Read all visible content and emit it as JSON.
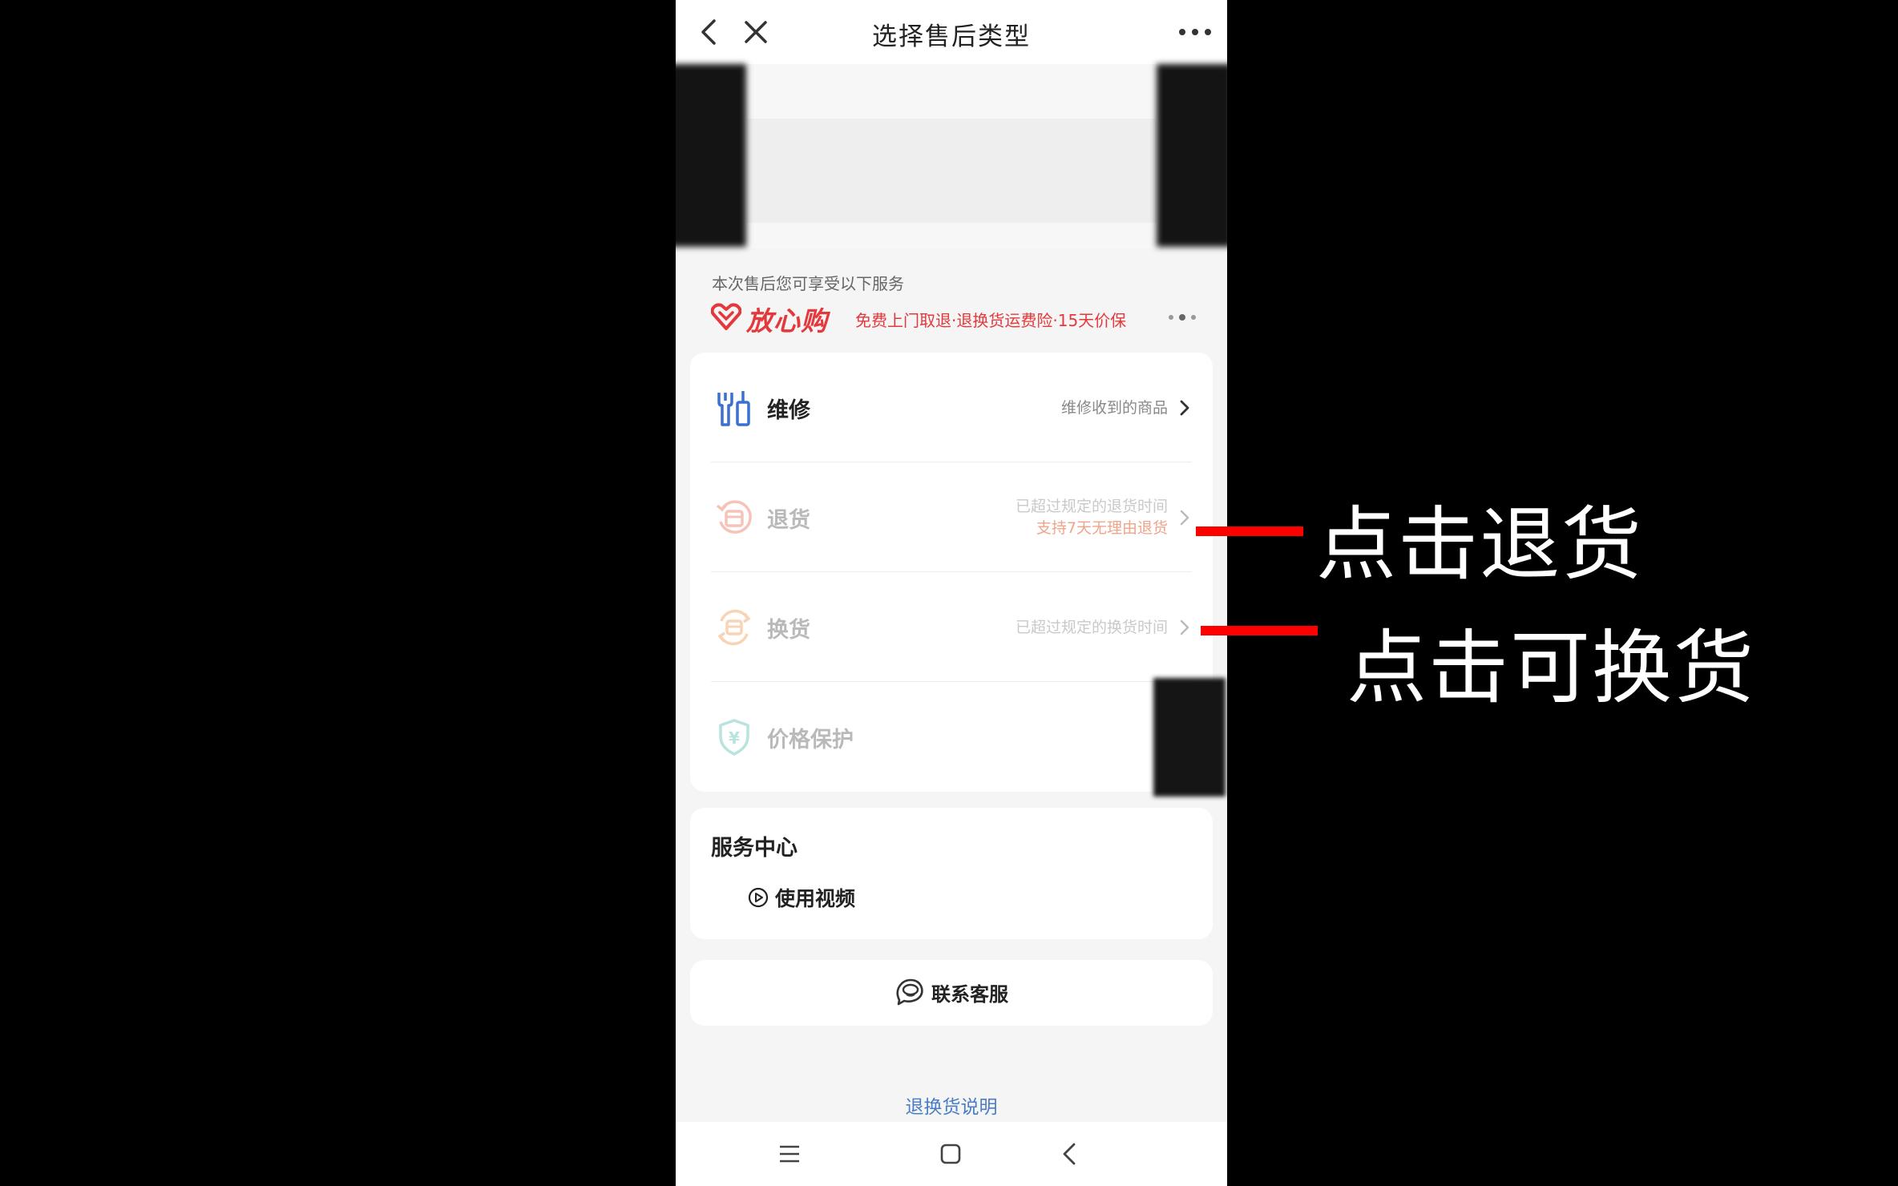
{
  "navbar": {
    "title": "选择售后类型",
    "back_icon": "chevron-left-icon",
    "close_icon": "close-icon",
    "more_icon": "more-dots-icon"
  },
  "assurance": {
    "hint": "本次售后您可享受以下服务",
    "brand": "放心购",
    "description": "免费上门取退·退换货运费险·15天价保"
  },
  "options": [
    {
      "label": "维修",
      "description": "维修收到的商品",
      "icon": "repair-tools-icon",
      "enabled": true
    },
    {
      "label": "退货",
      "description": "已超过规定的退货时间",
      "description_accent": "支持7天无理由退货",
      "icon": "return-box-icon",
      "enabled": false
    },
    {
      "label": "换货",
      "description": "已超过规定的换货时间",
      "icon": "exchange-box-icon",
      "enabled": false
    },
    {
      "label": "价格保护",
      "icon": "price-shield-icon",
      "enabled": false
    }
  ],
  "service_center": {
    "title": "服务中心",
    "video_label": "使用视频"
  },
  "contact": {
    "label": "联系客服"
  },
  "policy_link": "退换货说明",
  "annotations": [
    {
      "text": "点击退货"
    },
    {
      "text": "点击可换货"
    }
  ],
  "colors": {
    "brand_red": "#e4393c",
    "link_blue": "#4a7dc4",
    "annotation_red": "#ff0000",
    "page_bg": "#f5f5f5"
  }
}
